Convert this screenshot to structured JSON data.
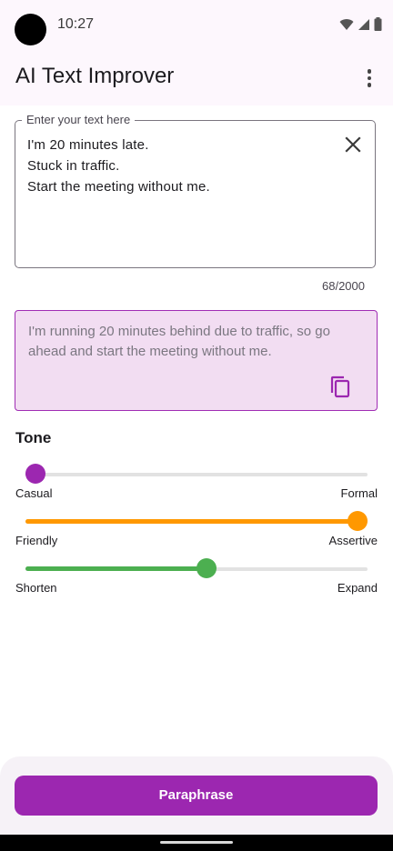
{
  "status_bar": {
    "time": "10:27"
  },
  "app_bar": {
    "title": "AI Text Improver",
    "menu_icon": "more-vert-icon"
  },
  "input": {
    "label": "Enter your text here",
    "value": "I'm 20 minutes late.\nStuck in traffic.\nStart the meeting without me.",
    "counter": "68/2000",
    "clear_icon": "close-icon"
  },
  "result": {
    "text": "I'm running 20 minutes behind due to traffic, so go ahead and start the meeting without me.",
    "copy_icon": "copy-icon"
  },
  "tone": {
    "title": "Tone",
    "sliders": [
      {
        "min_label": "Casual",
        "max_label": "Formal",
        "value": 0.03,
        "color": "#9c27b0"
      },
      {
        "min_label": "Friendly",
        "max_label": "Assertive",
        "value": 0.97,
        "color": "#ff9800"
      },
      {
        "min_label": "Shorten",
        "max_label": "Expand",
        "value": 0.53,
        "color": "#4caf50"
      }
    ]
  },
  "action": {
    "paraphrase_label": "Paraphrase"
  }
}
